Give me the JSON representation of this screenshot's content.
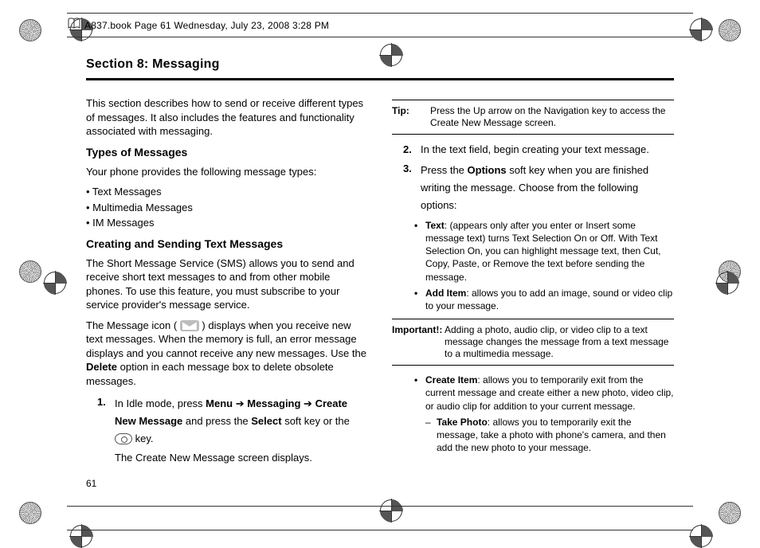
{
  "header": {
    "text": "A837.book  Page 61  Wednesday, July 23, 2008  3:28 PM"
  },
  "section_title": "Section 8: Messaging",
  "left": {
    "intro": "This section describes how to send or receive different types of messages. It also includes the features and functionality associated with messaging.",
    "types_h": "Types of Messages",
    "types_intro": "Your phone provides the following message types:",
    "types": [
      "• Text Messages",
      "• Multimedia Messages",
      "• IM Messages"
    ],
    "create_h": "Creating and Sending Text Messages",
    "sms_para": "The Short Message Service (SMS) allows you to send and receive short text messages to and from other mobile phones. To use this feature, you must subscribe to your service provider's message service.",
    "icon_para_a": "The Message icon (",
    "icon_para_b": ") displays when you receive new text messages. When the memory is full, an error message displays and you cannot receive any new messages. Use the ",
    "icon_para_bold": "Delete",
    "icon_para_c": " option in each message box to delete obsolete messages.",
    "step1_num": "1.",
    "step1_a": "In Idle mode, press ",
    "step1_b1": "Menu",
    "step1_arrow1": " ➔ ",
    "step1_b2": "Messaging",
    "step1_arrow2": " ➔ ",
    "step1_b3": "Create New Message",
    "step1_c": " and press the ",
    "step1_b4": "Select",
    "step1_d": " soft key or the ",
    "step1_e": " key.",
    "step1_f": "The Create New Message screen displays."
  },
  "right": {
    "tip_label": "Tip:",
    "tip_body": "Press the Up arrow on the Navigation key to access the Create New Message screen.",
    "step2_num": "2.",
    "step2": "In the text field, begin creating your text message.",
    "step3_num": "3.",
    "step3_a": "Press the ",
    "step3_bold": "Options",
    "step3_b": " soft key when you are finished writing the message. Choose from the following options:",
    "opt_text_label": "Text",
    "opt_text_body": ": (appears only after you enter or Insert some message text) turns Text Selection On or Off. With Text Selection On, you can highlight message text, then Cut, Copy, Paste, or Remove the text before sending the message.",
    "opt_add_label": "Add Item",
    "opt_add_body": ": allows you to add an image, sound or video clip to your message.",
    "imp_label": "Important!:",
    "imp_body": "Adding a photo, audio clip, or video clip to a text message changes the message from a text message to a multimedia message.",
    "opt_create_label": "Create Item",
    "opt_create_body": ": allows you to temporarily exit from the current message and create either a new photo, video clip, or audio clip for addition to your current message.",
    "sub_take_label": "Take Photo",
    "sub_take_body": ": allows you to temporarily exit the message, take a photo with phone's camera, and then add the new photo to your message."
  },
  "page_number": "61"
}
